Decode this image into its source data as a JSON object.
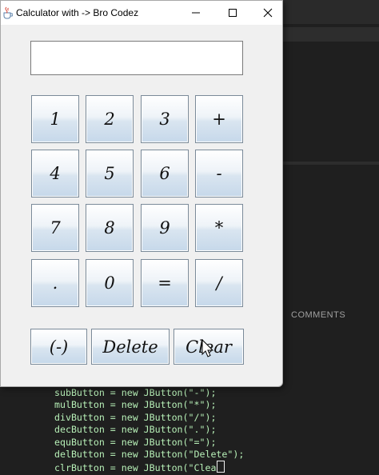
{
  "window": {
    "title": "Calculator with -> Bro Codez",
    "controls": [
      "minimize",
      "maximize",
      "close"
    ]
  },
  "display": {
    "value": ""
  },
  "keypad": [
    {
      "label": "1",
      "name": "one"
    },
    {
      "label": "2",
      "name": "two"
    },
    {
      "label": "3",
      "name": "three"
    },
    {
      "label": "+",
      "name": "add"
    },
    {
      "label": "4",
      "name": "four"
    },
    {
      "label": "5",
      "name": "five"
    },
    {
      "label": "6",
      "name": "six"
    },
    {
      "label": "-",
      "name": "subtract"
    },
    {
      "label": "7",
      "name": "seven"
    },
    {
      "label": "8",
      "name": "eight"
    },
    {
      "label": "9",
      "name": "nine"
    },
    {
      "label": "*",
      "name": "multiply"
    },
    {
      "label": ".",
      "name": "decimal"
    },
    {
      "label": "0",
      "name": "zero"
    },
    {
      "label": "=",
      "name": "equals"
    },
    {
      "label": "/",
      "name": "divide"
    }
  ],
  "bottom_buttons": {
    "negative": "(-)",
    "delete": "Delete",
    "clear": "Clear"
  },
  "editor": {
    "panel_label": "COMMENTS",
    "code_lines": [
      "subButton = new JButton(\"-\");",
      "mulButton = new JButton(\"*\");",
      "divButton = new JButton(\"/\");",
      "decButton = new JButton(\".\");",
      "equButton = new JButton(\"=\");",
      "delButton = new JButton(\"Delete\");",
      "clrButton = new JButton(\"Clea"
    ]
  }
}
